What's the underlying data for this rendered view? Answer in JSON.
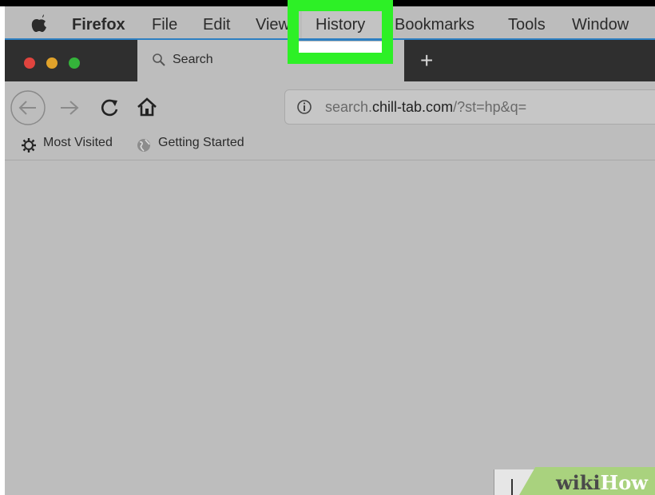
{
  "menubar": {
    "app_name": "Firefox",
    "items": [
      "File",
      "Edit",
      "View",
      "History",
      "Bookmarks",
      "Tools",
      "Window"
    ],
    "highlighted": "History"
  },
  "tabs": [
    {
      "label": "Search",
      "icon": "search-icon"
    }
  ],
  "new_tab_label": "+",
  "address_bar": {
    "url_prefix": "search.",
    "url_domain": "chill-tab.com",
    "url_suffix": "/?st=hp&q="
  },
  "bookmarks": [
    {
      "label": "Most Visited",
      "icon": "gear-icon"
    },
    {
      "label": "Getting Started",
      "icon": "globe-icon"
    }
  ],
  "watermark": {
    "wiki": "wiki",
    "how": "How"
  },
  "colors": {
    "highlight": "#2df026",
    "accent": "#2d7fc2",
    "close": "#e0443e",
    "minimize": "#e0a22a",
    "zoom": "#34b33a",
    "watermark_bg": "#a9d27e"
  }
}
